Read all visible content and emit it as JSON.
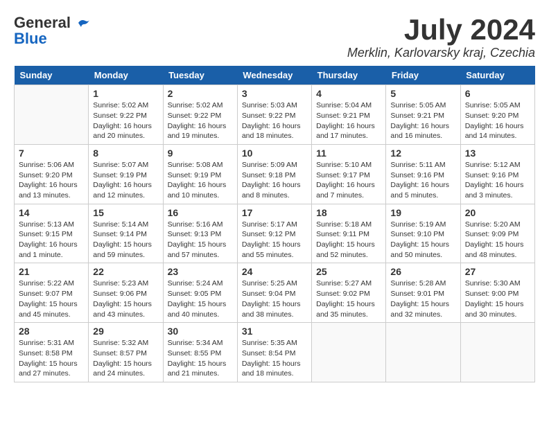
{
  "header": {
    "logo_general": "General",
    "logo_blue": "Blue",
    "month_year": "July 2024",
    "location": "Merklin, Karlovarsky kraj, Czechia"
  },
  "weekdays": [
    "Sunday",
    "Monday",
    "Tuesday",
    "Wednesday",
    "Thursday",
    "Friday",
    "Saturday"
  ],
  "weeks": [
    [
      {
        "day": "",
        "sunrise": "",
        "sunset": "",
        "daylight": ""
      },
      {
        "day": "1",
        "sunrise": "Sunrise: 5:02 AM",
        "sunset": "Sunset: 9:22 PM",
        "daylight": "Daylight: 16 hours and 20 minutes."
      },
      {
        "day": "2",
        "sunrise": "Sunrise: 5:02 AM",
        "sunset": "Sunset: 9:22 PM",
        "daylight": "Daylight: 16 hours and 19 minutes."
      },
      {
        "day": "3",
        "sunrise": "Sunrise: 5:03 AM",
        "sunset": "Sunset: 9:22 PM",
        "daylight": "Daylight: 16 hours and 18 minutes."
      },
      {
        "day": "4",
        "sunrise": "Sunrise: 5:04 AM",
        "sunset": "Sunset: 9:21 PM",
        "daylight": "Daylight: 16 hours and 17 minutes."
      },
      {
        "day": "5",
        "sunrise": "Sunrise: 5:05 AM",
        "sunset": "Sunset: 9:21 PM",
        "daylight": "Daylight: 16 hours and 16 minutes."
      },
      {
        "day": "6",
        "sunrise": "Sunrise: 5:05 AM",
        "sunset": "Sunset: 9:20 PM",
        "daylight": "Daylight: 16 hours and 14 minutes."
      }
    ],
    [
      {
        "day": "7",
        "sunrise": "Sunrise: 5:06 AM",
        "sunset": "Sunset: 9:20 PM",
        "daylight": "Daylight: 16 hours and 13 minutes."
      },
      {
        "day": "8",
        "sunrise": "Sunrise: 5:07 AM",
        "sunset": "Sunset: 9:19 PM",
        "daylight": "Daylight: 16 hours and 12 minutes."
      },
      {
        "day": "9",
        "sunrise": "Sunrise: 5:08 AM",
        "sunset": "Sunset: 9:19 PM",
        "daylight": "Daylight: 16 hours and 10 minutes."
      },
      {
        "day": "10",
        "sunrise": "Sunrise: 5:09 AM",
        "sunset": "Sunset: 9:18 PM",
        "daylight": "Daylight: 16 hours and 8 minutes."
      },
      {
        "day": "11",
        "sunrise": "Sunrise: 5:10 AM",
        "sunset": "Sunset: 9:17 PM",
        "daylight": "Daylight: 16 hours and 7 minutes."
      },
      {
        "day": "12",
        "sunrise": "Sunrise: 5:11 AM",
        "sunset": "Sunset: 9:16 PM",
        "daylight": "Daylight: 16 hours and 5 minutes."
      },
      {
        "day": "13",
        "sunrise": "Sunrise: 5:12 AM",
        "sunset": "Sunset: 9:16 PM",
        "daylight": "Daylight: 16 hours and 3 minutes."
      }
    ],
    [
      {
        "day": "14",
        "sunrise": "Sunrise: 5:13 AM",
        "sunset": "Sunset: 9:15 PM",
        "daylight": "Daylight: 16 hours and 1 minute."
      },
      {
        "day": "15",
        "sunrise": "Sunrise: 5:14 AM",
        "sunset": "Sunset: 9:14 PM",
        "daylight": "Daylight: 15 hours and 59 minutes."
      },
      {
        "day": "16",
        "sunrise": "Sunrise: 5:16 AM",
        "sunset": "Sunset: 9:13 PM",
        "daylight": "Daylight: 15 hours and 57 minutes."
      },
      {
        "day": "17",
        "sunrise": "Sunrise: 5:17 AM",
        "sunset": "Sunset: 9:12 PM",
        "daylight": "Daylight: 15 hours and 55 minutes."
      },
      {
        "day": "18",
        "sunrise": "Sunrise: 5:18 AM",
        "sunset": "Sunset: 9:11 PM",
        "daylight": "Daylight: 15 hours and 52 minutes."
      },
      {
        "day": "19",
        "sunrise": "Sunrise: 5:19 AM",
        "sunset": "Sunset: 9:10 PM",
        "daylight": "Daylight: 15 hours and 50 minutes."
      },
      {
        "day": "20",
        "sunrise": "Sunrise: 5:20 AM",
        "sunset": "Sunset: 9:09 PM",
        "daylight": "Daylight: 15 hours and 48 minutes."
      }
    ],
    [
      {
        "day": "21",
        "sunrise": "Sunrise: 5:22 AM",
        "sunset": "Sunset: 9:07 PM",
        "daylight": "Daylight: 15 hours and 45 minutes."
      },
      {
        "day": "22",
        "sunrise": "Sunrise: 5:23 AM",
        "sunset": "Sunset: 9:06 PM",
        "daylight": "Daylight: 15 hours and 43 minutes."
      },
      {
        "day": "23",
        "sunrise": "Sunrise: 5:24 AM",
        "sunset": "Sunset: 9:05 PM",
        "daylight": "Daylight: 15 hours and 40 minutes."
      },
      {
        "day": "24",
        "sunrise": "Sunrise: 5:25 AM",
        "sunset": "Sunset: 9:04 PM",
        "daylight": "Daylight: 15 hours and 38 minutes."
      },
      {
        "day": "25",
        "sunrise": "Sunrise: 5:27 AM",
        "sunset": "Sunset: 9:02 PM",
        "daylight": "Daylight: 15 hours and 35 minutes."
      },
      {
        "day": "26",
        "sunrise": "Sunrise: 5:28 AM",
        "sunset": "Sunset: 9:01 PM",
        "daylight": "Daylight: 15 hours and 32 minutes."
      },
      {
        "day": "27",
        "sunrise": "Sunrise: 5:30 AM",
        "sunset": "Sunset: 9:00 PM",
        "daylight": "Daylight: 15 hours and 30 minutes."
      }
    ],
    [
      {
        "day": "28",
        "sunrise": "Sunrise: 5:31 AM",
        "sunset": "Sunset: 8:58 PM",
        "daylight": "Daylight: 15 hours and 27 minutes."
      },
      {
        "day": "29",
        "sunrise": "Sunrise: 5:32 AM",
        "sunset": "Sunset: 8:57 PM",
        "daylight": "Daylight: 15 hours and 24 minutes."
      },
      {
        "day": "30",
        "sunrise": "Sunrise: 5:34 AM",
        "sunset": "Sunset: 8:55 PM",
        "daylight": "Daylight: 15 hours and 21 minutes."
      },
      {
        "day": "31",
        "sunrise": "Sunrise: 5:35 AM",
        "sunset": "Sunset: 8:54 PM",
        "daylight": "Daylight: 15 hours and 18 minutes."
      },
      {
        "day": "",
        "sunrise": "",
        "sunset": "",
        "daylight": ""
      },
      {
        "day": "",
        "sunrise": "",
        "sunset": "",
        "daylight": ""
      },
      {
        "day": "",
        "sunrise": "",
        "sunset": "",
        "daylight": ""
      }
    ]
  ]
}
